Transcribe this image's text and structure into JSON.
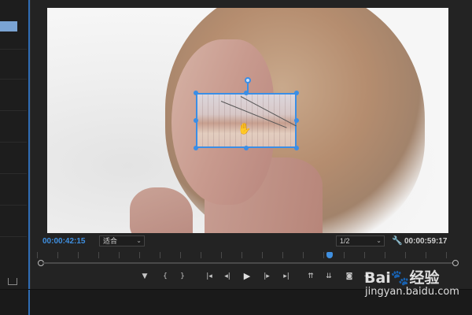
{
  "monitor": {
    "current_timecode": "00:00:42:15",
    "duration_timecode": "00:00:59:17",
    "zoom_select": {
      "value": "适合"
    },
    "resolution_select": {
      "value": "1/2"
    },
    "playhead_fraction": 0.7
  },
  "transport": {
    "buttons": [
      {
        "icon": "marker-icon",
        "glyph": "▼"
      },
      {
        "icon": "mark-in-icon",
        "glyph": "{"
      },
      {
        "icon": "mark-out-icon",
        "glyph": "}"
      },
      {
        "icon": "go-to-in-icon",
        "glyph": "|◂"
      },
      {
        "icon": "step-back-icon",
        "glyph": "◂|"
      },
      {
        "icon": "play-icon",
        "glyph": "▶"
      },
      {
        "icon": "step-forward-icon",
        "glyph": "|▸"
      },
      {
        "icon": "go-to-out-icon",
        "glyph": "▸|"
      },
      {
        "icon": "lift-icon",
        "glyph": "⇈"
      },
      {
        "icon": "extract-icon",
        "glyph": "⇊"
      },
      {
        "icon": "export-frame-icon",
        "glyph": "◙"
      },
      {
        "icon": "add-icon",
        "glyph": "+"
      }
    ]
  },
  "watermark": {
    "brand": "Bai",
    "brand_suffix": "经验",
    "url": "jingyan.baidu.com"
  },
  "colors": {
    "accent": "#3f8fe0",
    "selection": "#3a8ee6",
    "panel_bg": "#232323"
  }
}
